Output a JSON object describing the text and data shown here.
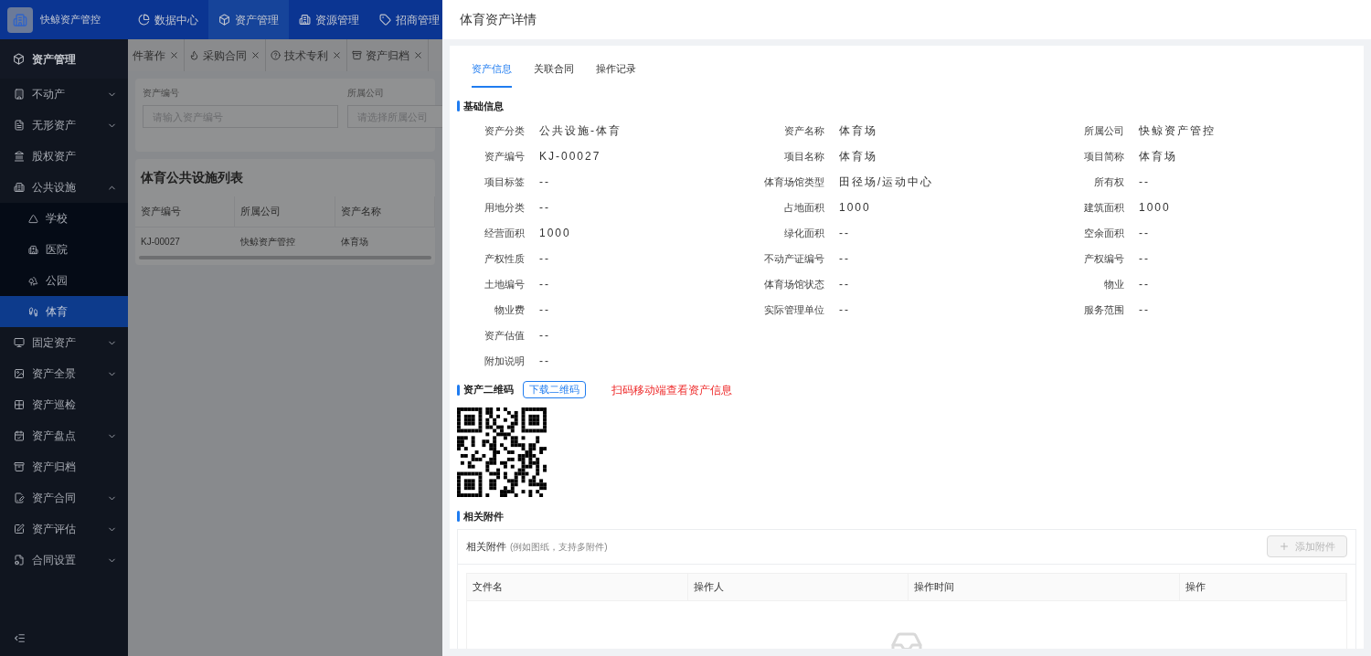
{
  "header": {
    "brand": "快鲸资产管控",
    "nav": [
      {
        "label": "数据中心",
        "selected": false
      },
      {
        "label": "资产管理",
        "selected": true
      },
      {
        "label": "资源管理",
        "selected": false
      },
      {
        "label": "招商管理",
        "selected": false
      }
    ]
  },
  "open_tabs": [
    {
      "label": "件著作"
    },
    {
      "label": "采购合同"
    },
    {
      "label": "技术专利"
    },
    {
      "label": "资产归档"
    }
  ],
  "sidebar": {
    "title": "资产管理",
    "items": [
      {
        "label": "不动产",
        "kind": "group",
        "expanded": false
      },
      {
        "label": "无形资产",
        "kind": "group",
        "expanded": false
      },
      {
        "label": "股权资产",
        "kind": "leaf"
      },
      {
        "label": "公共设施",
        "kind": "group",
        "expanded": true,
        "children": [
          {
            "label": "学校",
            "selected": false
          },
          {
            "label": "医院",
            "selected": false
          },
          {
            "label": "公园",
            "selected": false
          },
          {
            "label": "体育",
            "selected": true
          }
        ]
      },
      {
        "label": "固定资产",
        "kind": "group",
        "expanded": false
      },
      {
        "label": "资产全景",
        "kind": "group",
        "expanded": false
      },
      {
        "label": "资产巡检",
        "kind": "leaf"
      },
      {
        "label": "资产盘点",
        "kind": "group",
        "expanded": false
      },
      {
        "label": "资产归档",
        "kind": "leaf"
      },
      {
        "label": "资产合同",
        "kind": "group",
        "expanded": false
      },
      {
        "label": "资产评估",
        "kind": "group",
        "expanded": false
      },
      {
        "label": "合同设置",
        "kind": "group",
        "expanded": false
      }
    ]
  },
  "filters": [
    {
      "label": "资产编号",
      "placeholder": "请输入资产编号"
    },
    {
      "label": "所属公司",
      "placeholder": "请选择所属公司"
    }
  ],
  "list": {
    "title": "体育公共设施列表",
    "columns": [
      "资产编号",
      "所属公司",
      "资产名称"
    ],
    "rows": [
      [
        "KJ-00027",
        "快鲸资产管控",
        "体育场"
      ]
    ]
  },
  "drawer": {
    "title": "体育资产详情",
    "tabs": [
      {
        "label": "资产信息",
        "selected": true
      },
      {
        "label": "关联合同",
        "selected": false
      },
      {
        "label": "操作记录",
        "selected": false
      }
    ],
    "basic_title": "基础信息",
    "fields": [
      {
        "label": "资产分类",
        "value": "公共设施-体育"
      },
      {
        "label": "资产名称",
        "value": "体育场"
      },
      {
        "label": "所属公司",
        "value": "快鲸资产管控"
      },
      {
        "label": "资产编号",
        "value": "KJ-00027"
      },
      {
        "label": "项目名称",
        "value": "体育场"
      },
      {
        "label": "项目简称",
        "value": "体育场"
      },
      {
        "label": "项目标签",
        "value": "--"
      },
      {
        "label": "体育场馆类型",
        "value": "田径场/运动中心"
      },
      {
        "label": "所有权",
        "value": "--"
      },
      {
        "label": "用地分类",
        "value": "--"
      },
      {
        "label": "占地面积",
        "value": "1000"
      },
      {
        "label": "建筑面积",
        "value": "1000"
      },
      {
        "label": "经营面积",
        "value": "1000"
      },
      {
        "label": "绿化面积",
        "value": "--"
      },
      {
        "label": "空余面积",
        "value": "--"
      },
      {
        "label": "产权性质",
        "value": "--"
      },
      {
        "label": "不动产证编号",
        "value": "--"
      },
      {
        "label": "产权编号",
        "value": "--"
      },
      {
        "label": "土地编号",
        "value": "--"
      },
      {
        "label": "体育场馆状态",
        "value": "--"
      },
      {
        "label": "物业",
        "value": "--"
      },
      {
        "label": "物业费",
        "value": "--"
      },
      {
        "label": "实际管理单位",
        "value": "--"
      },
      {
        "label": "服务范围",
        "value": "--"
      },
      {
        "label": "资产估值",
        "value": "--"
      },
      {
        "label": "附加说明",
        "value": "--"
      }
    ],
    "qr": {
      "title": "资产二维码",
      "button": "下载二维码",
      "hint": "扫码移动端查看资产信息"
    },
    "attachments": {
      "title": "相关附件",
      "box_title": "相关附件",
      "box_note": "(例如图纸，支持多附件)",
      "add_button": "添加附件",
      "add_disabled": true,
      "columns": [
        "文件名",
        "操作人",
        "操作时间",
        "操作"
      ]
    }
  }
}
